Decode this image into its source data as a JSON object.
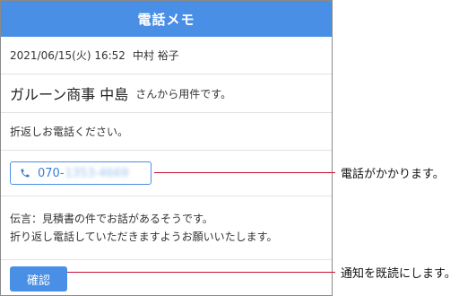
{
  "header": {
    "title": "電話メモ"
  },
  "meta": {
    "datetime": "2021/06/15(火) 16:52",
    "author": "中村 裕子"
  },
  "caller": {
    "company": "ガルーン商事 中島",
    "suffix": "さんから用件です。"
  },
  "message": "折返しお電話ください。",
  "phone": {
    "prefix": "070-",
    "masked": "1353-4669",
    "icon": "phone-icon"
  },
  "memo": {
    "line1": "伝言：見積書の件でお話があるそうです。",
    "line2": "折り返し電話していただきますようお願いいたします。"
  },
  "confirm_label": "確認",
  "annotations": {
    "phone": "電話がかかります。",
    "confirm": "通知を既読にします。"
  },
  "colors": {
    "accent": "#4a8fe6",
    "callout_line": "#c8102e"
  }
}
